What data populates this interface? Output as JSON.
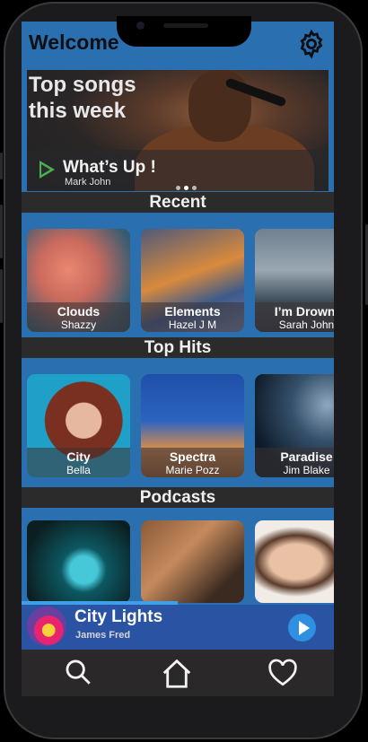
{
  "app": {
    "title": "Welcome"
  },
  "hero": {
    "heading_line1": "Top songs",
    "heading_line2": "this week",
    "song": "What’s Up !",
    "artist": "Mark John"
  },
  "sections": {
    "recent": "Recent",
    "top_hits": "Top Hits",
    "podcasts": "Podcasts"
  },
  "recent": [
    {
      "title": "Clouds",
      "artist": "Shazzy"
    },
    {
      "title": "Elements",
      "artist": "Hazel J M"
    },
    {
      "title": "I’m Drowni",
      "artist": "Sarah John"
    }
  ],
  "top_hits": [
    {
      "title": "City",
      "artist": "Bella"
    },
    {
      "title": "Spectra",
      "artist": "Marie Pozz"
    },
    {
      "title": "Paradise",
      "artist": "Jim Blake"
    }
  ],
  "player": {
    "title": "City Lights",
    "artist": "James Fred",
    "progress": 0.5
  },
  "icons": {
    "settings": "gear-icon",
    "play": "play-icon",
    "search": "search-icon",
    "home": "home-icon",
    "favorites": "heart-icon"
  },
  "colors": {
    "accent": "#2a6fb0",
    "bar": "#2c2b2b",
    "player": "#2b53a3"
  }
}
